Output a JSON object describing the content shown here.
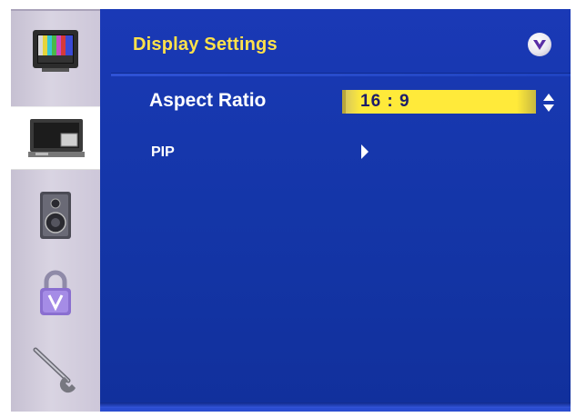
{
  "menu": {
    "title": "Display Settings",
    "sidebar": {
      "items": [
        {
          "name": "picture",
          "icon": "tv-color-bars-icon",
          "active": false
        },
        {
          "name": "display-settings",
          "icon": "monitor-icon",
          "active": true
        },
        {
          "name": "audio",
          "icon": "speaker-icon",
          "active": false
        },
        {
          "name": "parental-lock",
          "icon": "lock-icon",
          "active": false
        },
        {
          "name": "setup",
          "icon": "wrench-icon",
          "active": false
        }
      ]
    },
    "options": {
      "aspect_ratio": {
        "label": "Aspect Ratio",
        "value": "16 : 9"
      },
      "pip": {
        "label": "PIP"
      }
    }
  },
  "colors": {
    "panel_blue": "#1436a8",
    "title_yellow": "#ffe14a",
    "highlight_yellow": "#ffea3a",
    "sidebar_lavender": "#d9d4e2"
  }
}
